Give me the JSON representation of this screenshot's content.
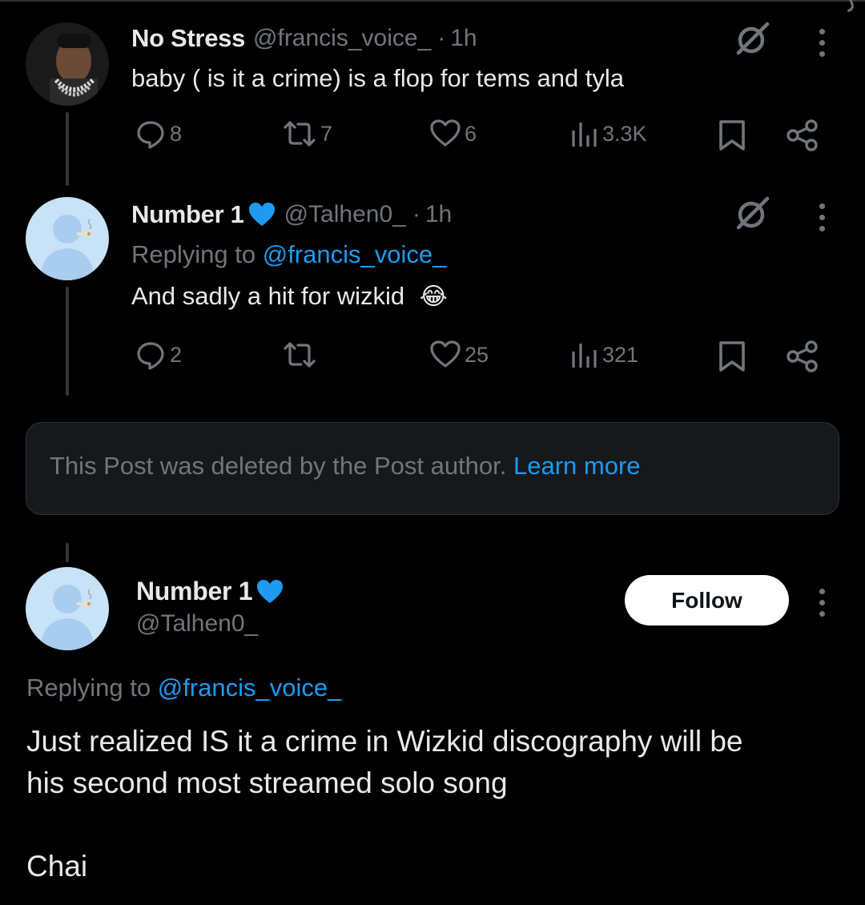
{
  "posts": [
    {
      "name": "No Stress",
      "handle": "@francis_voice_",
      "dot": "·",
      "time": "1h",
      "text": "baby ( is it a crime) is a flop for tems and tyla",
      "stats": {
        "replies": "8",
        "reposts": "7",
        "likes": "6",
        "views": "3.3K"
      }
    },
    {
      "name": "Number 1",
      "handle": "@Talhen0_",
      "dot": "·",
      "time": "1h",
      "replying_prefix": "Replying to ",
      "replying_to": "@francis_voice_",
      "text": "And sadly a hit for wizkid",
      "emoji": "😂",
      "stats": {
        "replies": "2",
        "reposts": "",
        "likes": "25",
        "views": "321"
      }
    }
  ],
  "deleted_notice": {
    "text": "This Post was deleted by the Post author.",
    "link": "Learn more"
  },
  "focused_post": {
    "name": "Number 1",
    "handle": "@Talhen0_",
    "follow_label": "Follow",
    "replying_prefix": "Replying to ",
    "replying_to": "@francis_voice_",
    "text_line1": "Just realized IS it a crime in Wizkid discography will be",
    "text_line2": "his second most streamed solo song",
    "text_line3": "Chai"
  },
  "colors": {
    "background": "#000000",
    "text": "#e7e9ea",
    "muted": "#71767b",
    "accent": "#1d9bf0",
    "verified_heart": "#1d9bf0"
  },
  "icons": [
    "reply-icon",
    "repost-icon",
    "like-icon",
    "views-icon",
    "bookmark-icon",
    "share-icon",
    "grok-icon",
    "more-icon",
    "blue-heart-icon"
  ]
}
